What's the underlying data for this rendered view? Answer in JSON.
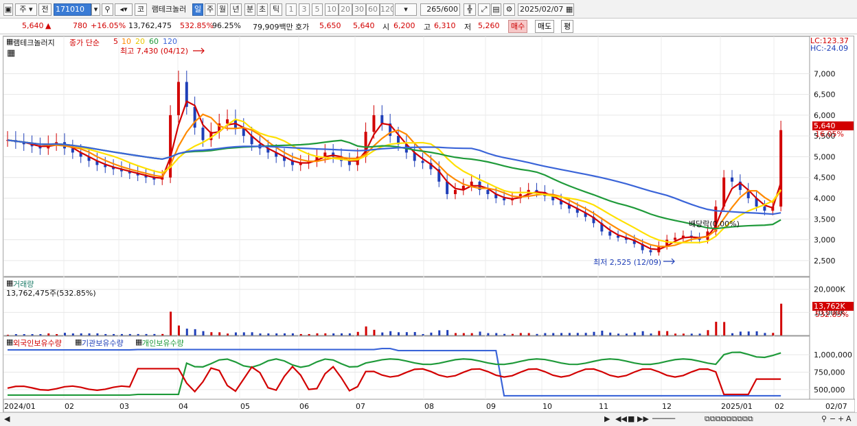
{
  "toolbar": {
    "market": "주",
    "mode": "전",
    "code": "171010",
    "stock_icon": "코",
    "stock_name": "램테크놀러",
    "period_tabs": [
      "일",
      "주",
      "월",
      "년",
      "분",
      "초",
      "틱"
    ],
    "period_selected": "일",
    "tick_options": [
      "1",
      "3",
      "5",
      "10",
      "20",
      "30",
      "60",
      "120"
    ],
    "count": "265",
    "count_max": "/600",
    "date": "2025/02/07"
  },
  "quote": {
    "price": "5,640",
    "change": "780",
    "change_pct": "+16.05%",
    "volume": "13,762,475",
    "vol_ratio": "532.85%",
    "turnover": "96.25%",
    "amount": "79,909백만",
    "bid_label": "호가",
    "bid1": "5,650",
    "bid2": "5,640",
    "open_label": "시",
    "open": "6,200",
    "high_label": "고",
    "high": "6,310",
    "low_label": "저",
    "low": "5,260",
    "buy": "매수",
    "sell": "매도",
    "avg": "평"
  },
  "legend": {
    "title": "램테크놀러지",
    "series_label": "종가 단순",
    "ma": [
      "5",
      "10",
      "20",
      "60",
      "120"
    ],
    "lc": "LC:123.37",
    "hc": "HC:-24.09",
    "high_note": "최고 7,430 (04/12)",
    "low_note": "최저 2,525 (12/09)",
    "dividend": "배당락(0.00%)",
    "last_price": "5,640",
    "last_pct": "16.05%"
  },
  "volume": {
    "title": "거래량",
    "value_text": "13,762,475주(532.85%)",
    "last": "13,762K",
    "last_pct": "532.85%",
    "axis": [
      "20,000K",
      "10,000K"
    ]
  },
  "holdings": {
    "foreign": "외국인보유수량",
    "inst": "기관보유수량",
    "indiv": "개인보유수량",
    "axis": [
      "1,000,000",
      "750,000",
      "500,000"
    ]
  },
  "colors": {
    "up": "#d20000",
    "down": "#1f3fb8",
    "ma5": "#d20000",
    "ma10": "#ff8a00",
    "ma20": "#ffe000",
    "ma60": "#1f9a3a",
    "ma120": "#3a64d8"
  },
  "chart_data": {
    "type": "candlestick",
    "price_axis": [
      7000,
      6500,
      6000,
      5500,
      5000,
      4500,
      4000,
      3500,
      3000,
      2500
    ],
    "x_labels": [
      "2024/01",
      "02",
      "03",
      "04",
      "05",
      "06",
      "07",
      "08",
      "09",
      "10",
      "11",
      "12",
      "2025/01",
      "02"
    ],
    "x_right_label": "02/07",
    "close": [
      5400,
      5350,
      5300,
      5250,
      5200,
      5300,
      5350,
      5200,
      5100,
      5000,
      4900,
      4800,
      4750,
      4700,
      4650,
      4600,
      4550,
      4500,
      4450,
      4500,
      6000,
      6800,
      6200,
      5700,
      5400,
      5600,
      5800,
      5900,
      5700,
      5500,
      5300,
      5200,
      5100,
      5000,
      4900,
      4800,
      4850,
      4900,
      5000,
      5100,
      5000,
      4900,
      4800,
      5000,
      5600,
      6000,
      5800,
      5500,
      5300,
      5100,
      4900,
      4850,
      4700,
      4400,
      4100,
      4200,
      4300,
      4400,
      4200,
      4100,
      4000,
      3950,
      4000,
      4100,
      4200,
      4150,
      4050,
      3950,
      3850,
      3750,
      3650,
      3550,
      3400,
      3200,
      3100,
      3050,
      3000,
      2900,
      2750,
      2700,
      2850,
      3000,
      3050,
      3100,
      3050,
      3000,
      3200,
      3800,
      4500,
      4400,
      4200,
      4000,
      3800,
      3700,
      3800,
      5640
    ],
    "volume_note": "high volume bars near 04/12, 07/05, 2025/01 and 02/07"
  }
}
